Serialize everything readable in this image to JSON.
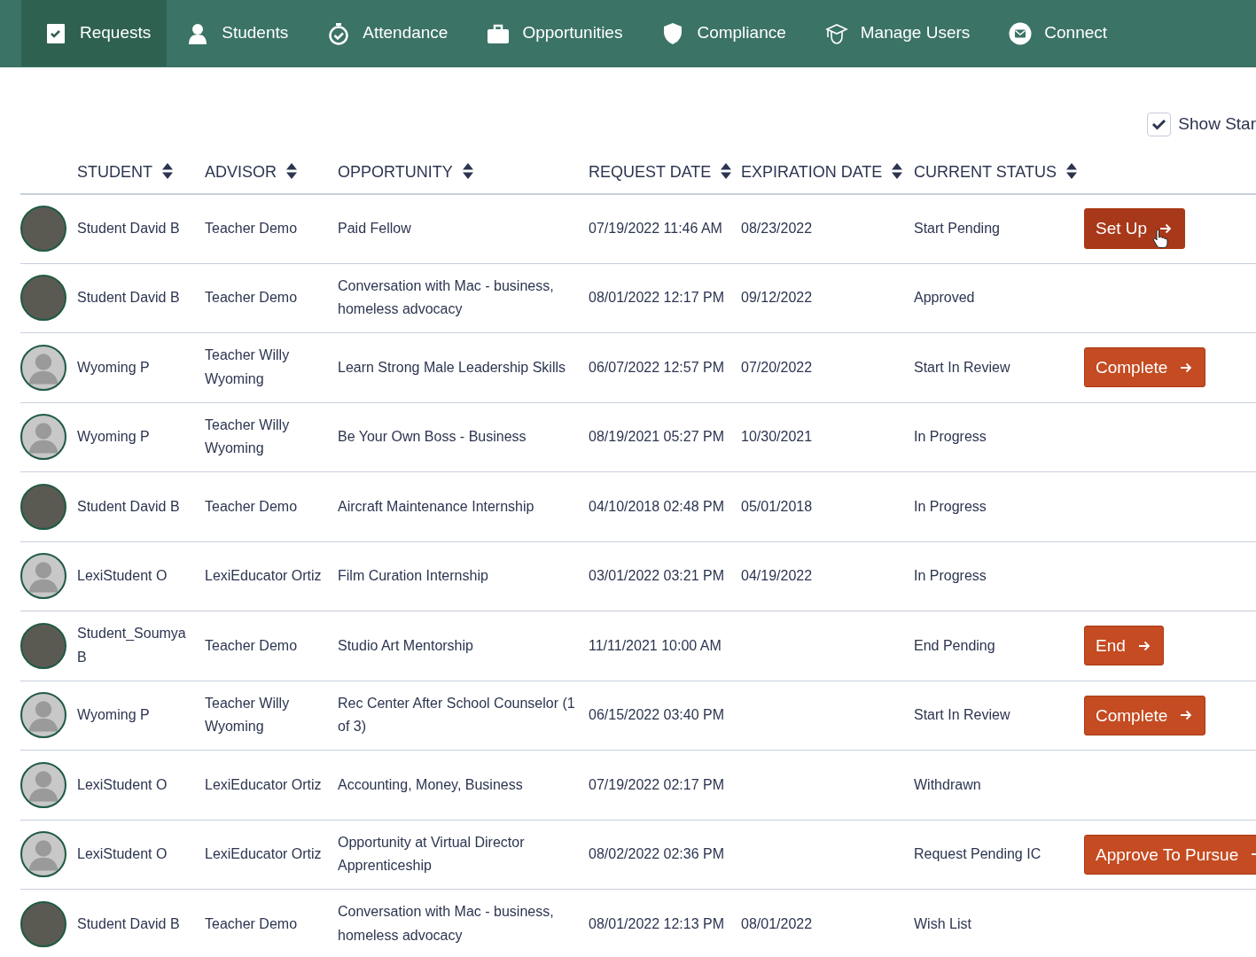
{
  "nav": [
    {
      "label": "Requests",
      "selected": true
    },
    {
      "label": "Students",
      "selected": false
    },
    {
      "label": "Attendance",
      "selected": false
    },
    {
      "label": "Opportunities",
      "selected": false
    },
    {
      "label": "Compliance",
      "selected": false
    },
    {
      "label": "Manage Users",
      "selected": false
    },
    {
      "label": "Connect",
      "selected": false
    }
  ],
  "show_toggle": {
    "label": "Show Star",
    "checked": true
  },
  "table": {
    "columns": [
      "STUDENT",
      "ADVISOR",
      "OPPORTUNITY",
      "REQUEST DATE",
      "EXPIRATION DATE",
      "CURRENT STATUS"
    ],
    "rows": [
      {
        "kind": "photo",
        "student": "Student David B",
        "advisor": "Teacher Demo",
        "opportunity": "Paid Fellow",
        "request_date": "07/19/2022 11:46 AM",
        "expiration_date": "08/23/2022",
        "status": "Start Pending",
        "action": {
          "label": "Set Up",
          "hovered": true
        }
      },
      {
        "kind": "photo",
        "student": "Student David B",
        "advisor": "Teacher Demo",
        "opportunity": "Conversation with Mac - business, homeless advocacy",
        "request_date": "08/01/2022 12:17 PM",
        "expiration_date": "09/12/2022",
        "status": "Approved"
      },
      {
        "kind": "default",
        "student": "Wyoming P",
        "advisor": "Teacher Willy Wyoming",
        "opportunity": "Learn Strong Male Leadership Skills",
        "request_date": "06/07/2022 12:57 PM",
        "expiration_date": "07/20/2022",
        "status": "Start In Review",
        "action": {
          "label": "Complete",
          "hovered": false
        }
      },
      {
        "kind": "default",
        "student": "Wyoming P",
        "advisor": "Teacher Willy Wyoming",
        "opportunity": "Be Your Own Boss - Business",
        "request_date": "08/19/2021 05:27 PM",
        "expiration_date": "10/30/2021",
        "status": "In Progress"
      },
      {
        "kind": "photo",
        "student": "Student David B",
        "advisor": "Teacher Demo",
        "opportunity": "Aircraft Maintenance Internship",
        "request_date": "04/10/2018 02:48 PM",
        "expiration_date": "05/01/2018",
        "status": "In Progress"
      },
      {
        "kind": "default",
        "student": "LexiStudent O",
        "advisor": "LexiEducator Ortiz",
        "opportunity": "Film Curation Internship",
        "request_date": "03/01/2022 03:21 PM",
        "expiration_date": "04/19/2022",
        "status": "In Progress"
      },
      {
        "kind": "photo",
        "student": "Student_Soumya B",
        "advisor": "Teacher Demo",
        "opportunity": "Studio Art Mentorship",
        "request_date": "11/11/2021 10:00 AM",
        "status": "End Pending",
        "action": {
          "label": "End",
          "hovered": false
        }
      },
      {
        "kind": "default",
        "student": "Wyoming P",
        "advisor": "Teacher Willy Wyoming",
        "opportunity": "Rec Center After School Counselor (1 of 3)",
        "request_date": "06/15/2022 03:40 PM",
        "status": "Start In Review",
        "action": {
          "label": "Complete",
          "hovered": false
        }
      },
      {
        "kind": "default",
        "student": "LexiStudent O",
        "advisor": "LexiEducator Ortiz",
        "opportunity": "Accounting, Money, Business",
        "request_date": "07/19/2022 02:17 PM",
        "status": "Withdrawn"
      },
      {
        "kind": "default",
        "student": "LexiStudent O",
        "advisor": "LexiEducator Ortiz",
        "opportunity": "Opportunity at Virtual Director Apprenticeship",
        "request_date": "08/02/2022 02:36 PM",
        "status": "Request Pending IC",
        "action": {
          "label": "Approve To Pursue",
          "hovered": false
        }
      },
      {
        "kind": "photo",
        "student": "Student David B",
        "advisor": "Teacher Demo",
        "opportunity": "Conversation with Mac - business, homeless advocacy",
        "request_date": "08/01/2022 12:13 PM",
        "expiration_date": "08/01/2022",
        "status": "Wish List"
      }
    ]
  }
}
